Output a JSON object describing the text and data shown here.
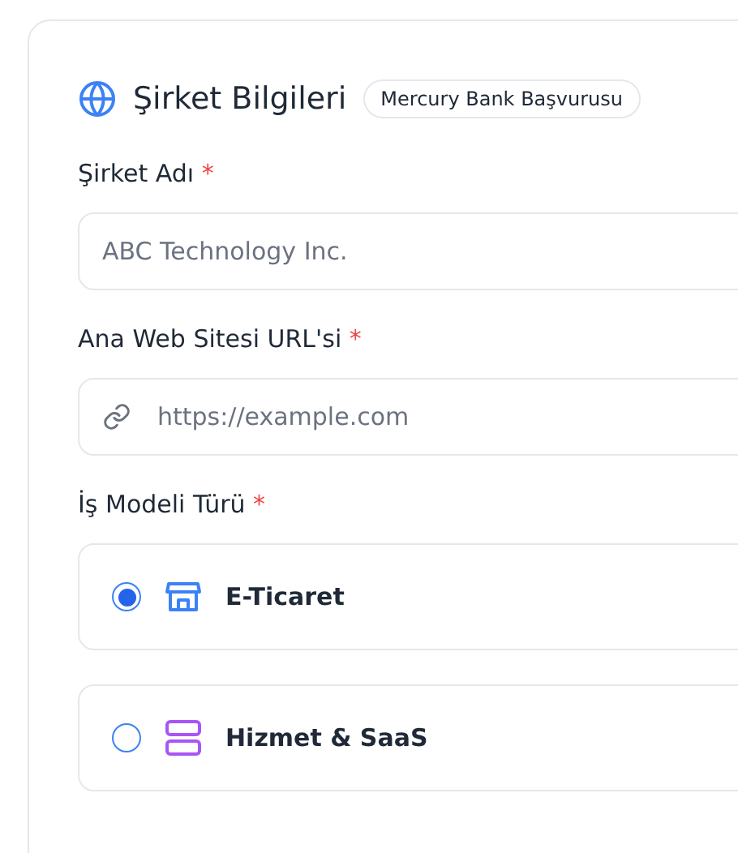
{
  "section": {
    "title": "Şirket Bilgileri",
    "badge": "Mercury Bank Başvurusu"
  },
  "fields": [
    {
      "label": "Şirket Adı",
      "required_mark": "*",
      "kind": "text",
      "placeholder": "ABC Technology Inc."
    },
    {
      "label": "Ana Web Sitesi URL'si",
      "required_mark": "*",
      "kind": "url",
      "placeholder": "https://example.com"
    }
  ],
  "business_model": {
    "label": "İş Modeli Türü",
    "required_mark": "*",
    "options": [
      {
        "label": "E-Ticaret",
        "kind": "store",
        "selected": true
      },
      {
        "label": "Hizmet & SaaS",
        "kind": "server",
        "selected": false
      }
    ]
  }
}
